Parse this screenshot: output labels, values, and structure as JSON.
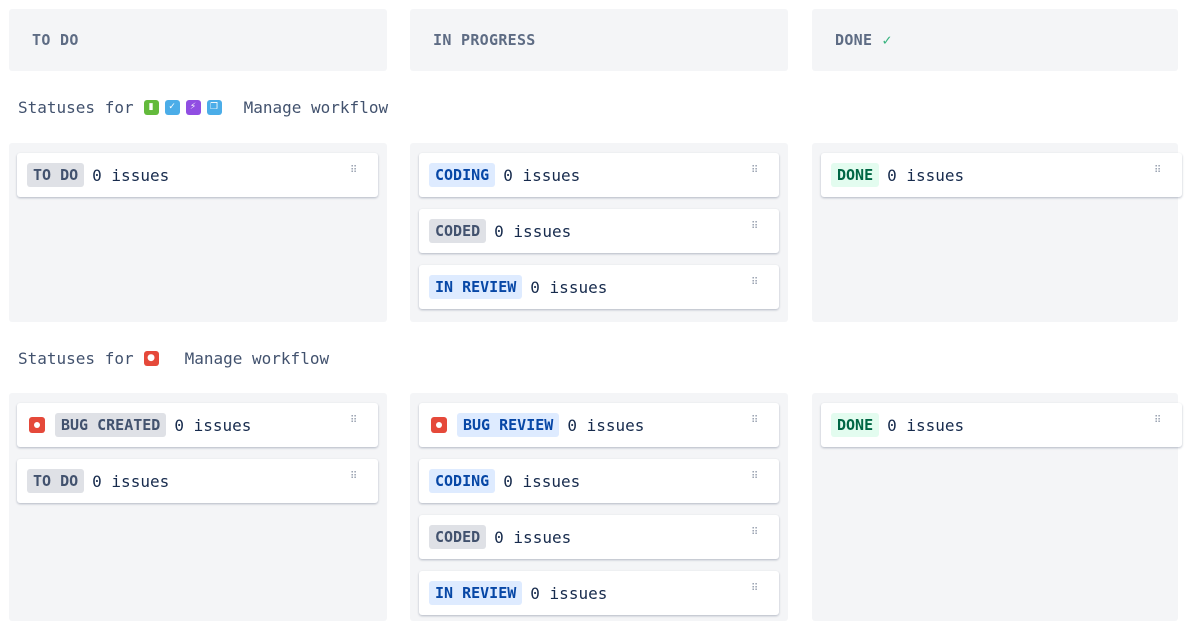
{
  "columns": [
    {
      "title": "TO DO"
    },
    {
      "title": "IN PROGRESS"
    },
    {
      "title": "DONE",
      "check": "✓"
    }
  ],
  "sections": [
    {
      "label": "Statuses for",
      "manage": "Manage workflow",
      "issue_type_icons": [
        {
          "name": "story-icon",
          "color": "#63ba3c",
          "glyph": "▮"
        },
        {
          "name": "task-icon",
          "color": "#4bade8",
          "glyph": "✓"
        },
        {
          "name": "epic-icon",
          "color": "#904ee2",
          "glyph": "⚡"
        },
        {
          "name": "subtask-icon",
          "color": "#4bade8",
          "glyph": "❐"
        }
      ],
      "todo": [
        {
          "status": "TO DO",
          "count": "0 issues",
          "style": "grey"
        }
      ],
      "in_progress": [
        {
          "status": "CODING",
          "count": "0 issues",
          "style": "blue"
        },
        {
          "status": "CODED",
          "count": "0 issues",
          "style": "grey"
        },
        {
          "status": "IN REVIEW",
          "count": "0 issues",
          "style": "blue"
        }
      ],
      "done": [
        {
          "status": "DONE",
          "count": "0 issues",
          "style": "green"
        }
      ]
    },
    {
      "label": "Statuses for",
      "manage": "Manage workflow",
      "issue_type_icons": [
        {
          "name": "bug-icon",
          "color": "#e5493a",
          "glyph": "●"
        }
      ],
      "todo": [
        {
          "status": "BUG CREATED",
          "count": "0 issues",
          "style": "grey",
          "bug": true
        },
        {
          "status": "TO DO",
          "count": "0 issues",
          "style": "grey"
        }
      ],
      "in_progress": [
        {
          "status": "BUG REVIEW",
          "count": "0 issues",
          "style": "blue",
          "bug": true
        },
        {
          "status": "CODING",
          "count": "0 issues",
          "style": "blue"
        },
        {
          "status": "CODED",
          "count": "0 issues",
          "style": "grey"
        },
        {
          "status": "IN REVIEW",
          "count": "0 issues",
          "style": "blue"
        }
      ],
      "done": [
        {
          "status": "DONE",
          "count": "0 issues",
          "style": "green"
        }
      ]
    }
  ],
  "grip_glyph": "⠿"
}
